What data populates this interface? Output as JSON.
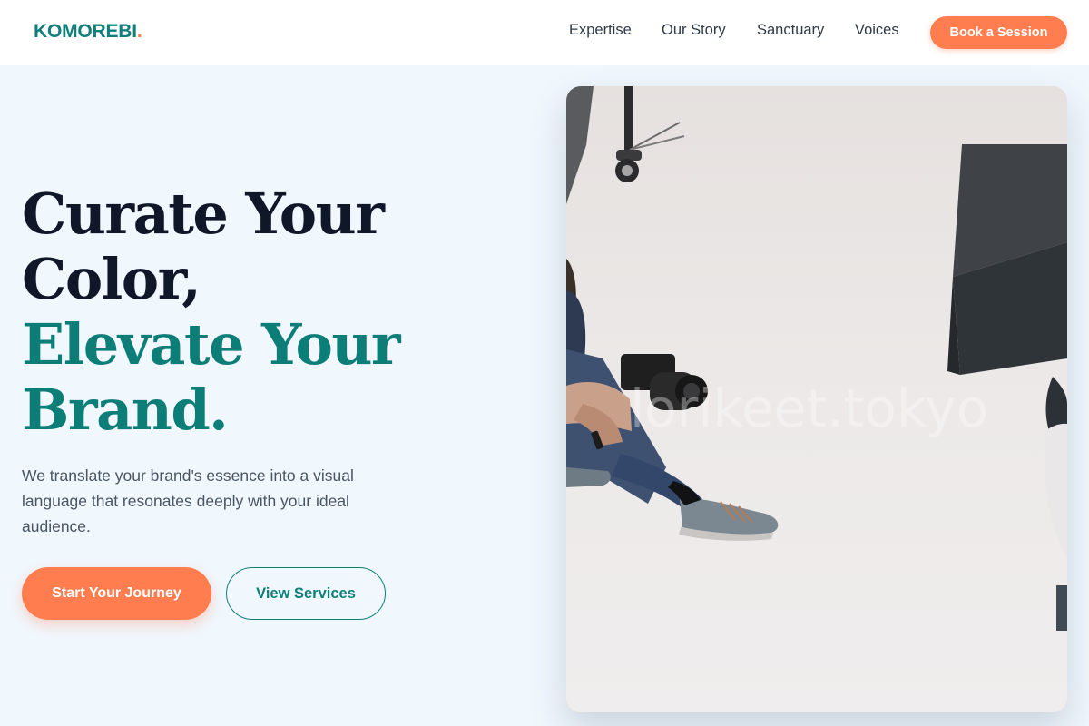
{
  "brand": {
    "name": "KOMOREBI",
    "dot": "."
  },
  "nav": {
    "items": [
      {
        "label": "Expertise"
      },
      {
        "label": "Our Story"
      },
      {
        "label": "Sanctuary"
      },
      {
        "label": "Voices"
      }
    ],
    "cta_label": "Book a Session"
  },
  "hero": {
    "headline_line1": "Curate Your",
    "headline_line2": "Color,",
    "headline_line3": "Elevate Your",
    "headline_line4": "Brand.",
    "description": "We translate your brand's essence into a visual language that resonates deeply with your ideal audience.",
    "primary_cta": "Start Your Journey",
    "secondary_cta": "View Services",
    "image_watermark": "lorikeet.tokyo"
  },
  "colors": {
    "brand_teal": "#0f7f7b",
    "accent_orange": "#ff7d4f",
    "heading_dark": "#0f1729",
    "page_background": "#f0f7fd"
  }
}
